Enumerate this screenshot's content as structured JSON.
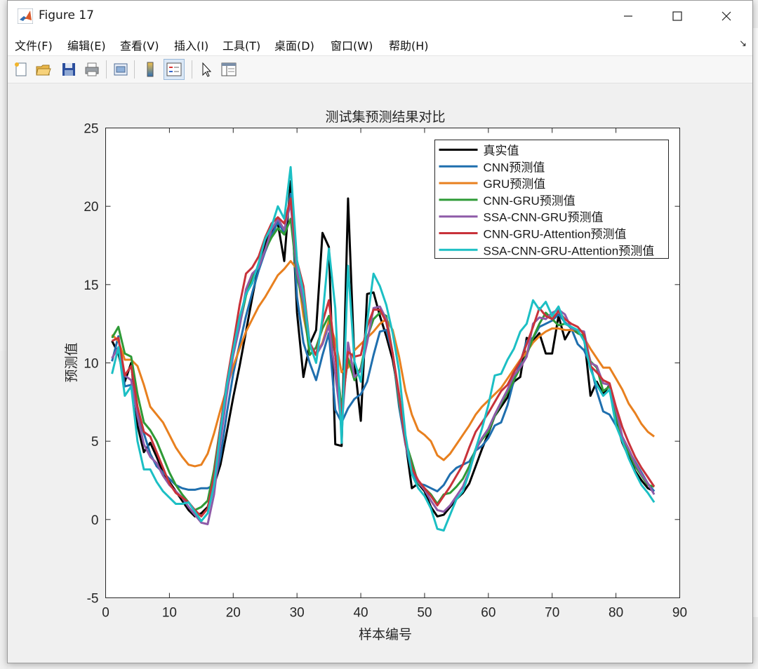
{
  "window": {
    "title": "Figure 17"
  },
  "menu": {
    "file": "文件(F)",
    "edit": "编辑(E)",
    "view": "查看(V)",
    "insert": "插入(I)",
    "tools": "工具(T)",
    "desktop": "桌面(D)",
    "window": "窗口(W)",
    "help": "帮助(H)"
  },
  "toolbar": {
    "icons": [
      "new-figure-icon",
      "open-file-icon",
      "save-icon",
      "print-icon",
      "print-preview-icon",
      "colorbar-icon",
      "legend-icon",
      "pointer-icon",
      "property-editor-icon"
    ]
  },
  "chart_data": {
    "type": "line",
    "title": "测试集预测结果对比",
    "xlabel": "样本编号",
    "ylabel": "预测值",
    "xlim": [
      0,
      90
    ],
    "ylim": [
      -5,
      25
    ],
    "xticks": [
      "0",
      "10",
      "20",
      "30",
      "40",
      "50",
      "60",
      "70",
      "80",
      "90"
    ],
    "yticks": [
      "-5",
      "0",
      "5",
      "10",
      "15",
      "20",
      "25"
    ],
    "legend_position": "top-right",
    "x": [
      1,
      2,
      3,
      4,
      5,
      6,
      7,
      8,
      9,
      10,
      11,
      12,
      13,
      14,
      15,
      16,
      17,
      18,
      19,
      20,
      21,
      22,
      23,
      24,
      25,
      26,
      27,
      28,
      29,
      30,
      31,
      32,
      33,
      34,
      35,
      36,
      37,
      38,
      39,
      40,
      41,
      42,
      43,
      44,
      45,
      46,
      47,
      48,
      49,
      50,
      51,
      52,
      53,
      54,
      55,
      56,
      57,
      58,
      59,
      60,
      61,
      62,
      63,
      64,
      65,
      66,
      67,
      68,
      69,
      70,
      71,
      72,
      73,
      74,
      75,
      76,
      77,
      78,
      79,
      80,
      81,
      82,
      83,
      84,
      85,
      86
    ],
    "series": [
      {
        "name": "真实值",
        "color": "#000000",
        "values": [
          11.4,
          10.6,
          8.8,
          10.0,
          6.0,
          4.3,
          4.9,
          4.0,
          3.0,
          2.4,
          1.8,
          1.2,
          0.6,
          0.2,
          0.4,
          0.8,
          2.2,
          3.5,
          5.6,
          7.8,
          9.8,
          12.0,
          14.2,
          16.3,
          17.6,
          18.4,
          18.9,
          16.5,
          21.6,
          13.2,
          9.1,
          11.2,
          12.1,
          18.3,
          17.4,
          4.8,
          4.7,
          20.5,
          10.0,
          6.3,
          14.4,
          14.5,
          13.0,
          11.7,
          10.2,
          7.8,
          5.0,
          2.0,
          2.3,
          1.8,
          0.8,
          0.2,
          0.3,
          0.8,
          1.3,
          1.7,
          2.3,
          3.4,
          4.5,
          5.5,
          6.6,
          7.2,
          7.8,
          8.8,
          9.1,
          11.6,
          11.4,
          11.9,
          10.6,
          10.6,
          13.0,
          11.5,
          12.2,
          11.9,
          11.7,
          7.9,
          8.8,
          8.0,
          8.6,
          6.3,
          4.9,
          4.0,
          3.1,
          2.5,
          2.0,
          1.8
        ]
      },
      {
        "name": "CNN预测值",
        "color": "#1f6fae",
        "values": [
          10.1,
          11.7,
          8.5,
          8.6,
          6.8,
          5.5,
          4.2,
          3.4,
          3.0,
          2.6,
          2.2,
          2.0,
          1.9,
          1.9,
          2.0,
          2.0,
          2.2,
          4.0,
          6.8,
          9.3,
          11.2,
          13.0,
          14.5,
          15.9,
          17.1,
          18.1,
          19.0,
          18.3,
          20.8,
          14.2,
          11.3,
          10.0,
          8.9,
          10.5,
          11.9,
          7.0,
          6.2,
          7.1,
          7.7,
          8.0,
          8.8,
          10.5,
          12.0,
          12.1,
          10.6,
          7.2,
          4.8,
          3.0,
          2.3,
          2.2,
          2.0,
          1.8,
          2.2,
          2.9,
          3.3,
          3.5,
          3.7,
          4.4,
          4.7,
          5.2,
          6.0,
          6.2,
          7.3,
          8.9,
          10.0,
          11.4,
          11.6,
          12.3,
          12.5,
          12.7,
          13.1,
          12.6,
          12.2,
          11.2,
          10.8,
          9.9,
          8.2,
          6.9,
          6.7,
          6.0,
          5.2,
          4.4,
          3.7,
          3.0,
          2.3,
          1.8
        ]
      },
      {
        "name": "GRU预测值",
        "color": "#e8801f",
        "values": [
          11.8,
          11.4,
          10.2,
          10.2,
          9.8,
          8.6,
          7.2,
          6.7,
          6.2,
          5.4,
          4.6,
          4.0,
          3.5,
          3.4,
          3.5,
          4.2,
          5.5,
          7.0,
          8.4,
          9.8,
          10.9,
          12.0,
          12.8,
          13.6,
          14.2,
          14.9,
          15.6,
          16.0,
          16.5,
          16.0,
          13.0,
          11.0,
          10.5,
          11.3,
          12.7,
          11.4,
          9.4,
          9.7,
          10.8,
          11.2,
          11.6,
          12.0,
          12.5,
          12.8,
          12.1,
          10.4,
          8.2,
          6.7,
          5.7,
          5.4,
          5.0,
          4.1,
          3.8,
          4.2,
          4.8,
          5.4,
          6.0,
          6.7,
          7.2,
          7.6,
          8.0,
          8.4,
          9.0,
          9.6,
          10.2,
          10.7,
          11.3,
          11.7,
          12.0,
          12.2,
          12.2,
          12.1,
          12.1,
          12.0,
          11.6,
          10.9,
          10.3,
          9.7,
          9.7,
          9.0,
          8.3,
          7.4,
          6.8,
          6.1,
          5.6,
          5.3
        ]
      },
      {
        "name": "CNN-GRU预测值",
        "color": "#2e9a36",
        "values": [
          11.6,
          12.3,
          10.6,
          10.4,
          8.0,
          6.2,
          5.7,
          5.0,
          4.0,
          3.0,
          2.2,
          1.6,
          1.1,
          0.6,
          0.8,
          1.2,
          3.2,
          6.0,
          8.5,
          10.5,
          12.4,
          14.3,
          15.5,
          16.2,
          17.2,
          18.0,
          18.6,
          18.2,
          19.2,
          15.5,
          13.7,
          10.5,
          11.0,
          12.2,
          13.0,
          10.5,
          7.2,
          10.3,
          8.9,
          9.7,
          11.6,
          12.8,
          13.2,
          13.0,
          10.6,
          7.5,
          5.0,
          3.7,
          2.3,
          2.0,
          1.6,
          1.0,
          1.6,
          1.7,
          2.1,
          2.6,
          3.4,
          4.5,
          5.1,
          5.6,
          6.6,
          7.4,
          8.1,
          8.9,
          9.7,
          10.5,
          11.6,
          12.5,
          13.2,
          12.8,
          12.4,
          12.5,
          12.3,
          11.9,
          11.7,
          10.1,
          9.7,
          8.2,
          8.5,
          6.6,
          5.1,
          4.3,
          3.4,
          2.8,
          2.2,
          2.1
        ]
      },
      {
        "name": "SSA-CNN-GRU预测值",
        "color": "#8e5ba8",
        "values": [
          10.3,
          11.0,
          9.2,
          8.9,
          6.6,
          4.8,
          4.0,
          3.6,
          2.8,
          2.2,
          1.8,
          1.4,
          0.8,
          0.3,
          -0.2,
          -0.3,
          1.6,
          5.0,
          8.0,
          10.5,
          12.3,
          14.7,
          15.7,
          16.1,
          17.2,
          18.5,
          19.2,
          18.5,
          20.2,
          15.8,
          13.9,
          11.3,
          10.5,
          11.2,
          12.4,
          9.3,
          5.9,
          11.3,
          9.1,
          9.5,
          11.3,
          13.5,
          13.6,
          12.8,
          10.6,
          7.8,
          4.8,
          3.3,
          2.4,
          1.9,
          1.2,
          0.6,
          0.5,
          0.9,
          1.5,
          2.1,
          3.1,
          4.4,
          5.2,
          5.8,
          6.7,
          7.5,
          8.3,
          9.2,
          9.7,
          10.4,
          12.5,
          12.9,
          12.8,
          13.2,
          13.4,
          13.1,
          12.2,
          12.1,
          12.0,
          10.0,
          9.8,
          8.7,
          8.6,
          7.0,
          5.3,
          4.5,
          3.6,
          2.9,
          2.3,
          1.6
        ]
      },
      {
        "name": "CNN-GRU-Attention预测值",
        "color": "#c8323a",
        "values": [
          11.4,
          11.6,
          9.2,
          9.8,
          7.2,
          5.6,
          5.3,
          4.3,
          3.3,
          2.3,
          1.7,
          1.4,
          1.1,
          0.6,
          0.2,
          0.7,
          2.8,
          6.0,
          8.8,
          11.2,
          13.7,
          15.7,
          16.1,
          16.8,
          18.0,
          18.9,
          19.3,
          18.9,
          20.5,
          16.5,
          14.9,
          11.2,
          10.5,
          12.6,
          14.0,
          10.5,
          6.7,
          10.7,
          10.4,
          10.5,
          12.3,
          13.4,
          13.4,
          12.6,
          10.6,
          8.0,
          5.0,
          3.3,
          2.5,
          2.0,
          1.5,
          0.9,
          1.5,
          2.1,
          2.8,
          3.5,
          4.6,
          5.6,
          6.2,
          6.8,
          7.5,
          8.2,
          8.6,
          9.4,
          10.1,
          11.2,
          12.3,
          13.5,
          13.0,
          12.8,
          13.3,
          12.8,
          12.5,
          12.3,
          11.8,
          9.8,
          9.4,
          8.9,
          8.7,
          7.2,
          5.9,
          4.9,
          4.0,
          3.3,
          2.7,
          2.1
        ]
      },
      {
        "name": "SSA-CNN-GRU-Attention预测值",
        "color": "#1cbfc4",
        "values": [
          9.3,
          11.0,
          7.9,
          8.5,
          5.0,
          3.2,
          3.2,
          2.4,
          1.8,
          1.4,
          1.0,
          1.0,
          1.1,
          0.5,
          -0.1,
          0.4,
          2.2,
          5.7,
          8.6,
          10.8,
          12.9,
          14.4,
          15.1,
          16.4,
          17.9,
          18.7,
          20.0,
          19.2,
          22.5,
          16.5,
          14.5,
          11.2,
          10.0,
          12.9,
          17.3,
          13.5,
          4.9,
          16.2,
          10.1,
          8.8,
          12.6,
          15.7,
          14.9,
          13.7,
          11.9,
          9.5,
          5.4,
          2.9,
          2.0,
          1.5,
          0.7,
          -0.6,
          -0.7,
          0.3,
          1.3,
          1.8,
          3.0,
          4.5,
          5.8,
          7.3,
          9.2,
          9.3,
          10.2,
          10.9,
          12.0,
          12.5,
          14.0,
          13.4,
          13.9,
          13.0,
          13.6,
          12.5,
          12.3,
          12.1,
          11.4,
          9.6,
          8.6,
          7.9,
          8.3,
          6.0,
          5.0,
          3.9,
          3.0,
          2.2,
          1.7,
          1.1
        ]
      }
    ]
  }
}
